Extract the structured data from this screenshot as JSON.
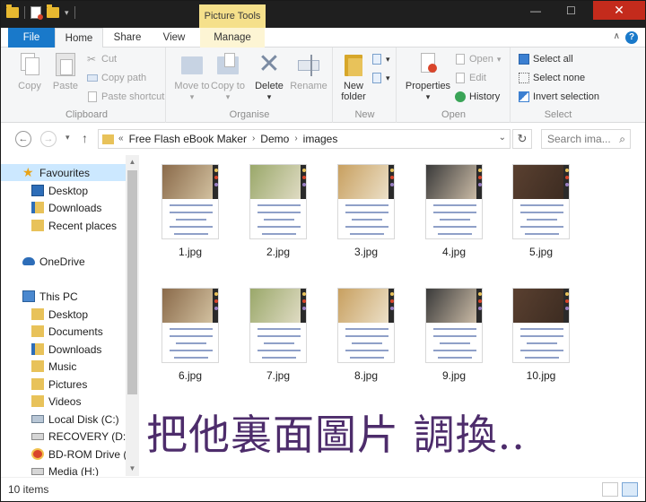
{
  "window": {
    "context_tab": "Picture Tools",
    "close_glyph": "✕",
    "minimize_glyph": "—",
    "maximize_glyph": "☐"
  },
  "tabs": {
    "file": "File",
    "home": "Home",
    "share": "Share",
    "view": "View",
    "manage": "Manage",
    "help": "?"
  },
  "ribbon": {
    "clipboard": {
      "label": "Clipboard",
      "copy": "Copy",
      "paste": "Paste",
      "cut": "Cut",
      "copy_path": "Copy path",
      "paste_shortcut": "Paste shortcut"
    },
    "organise": {
      "label": "Organise",
      "move_to": "Move to",
      "copy_to": "Copy to",
      "delete": "Delete",
      "rename": "Rename"
    },
    "new": {
      "label": "New",
      "new_folder": "New folder"
    },
    "open": {
      "label": "Open",
      "properties": "Properties",
      "open": "Open",
      "edit": "Edit",
      "history": "History"
    },
    "select": {
      "label": "Select",
      "select_all": "Select all",
      "select_none": "Select none",
      "invert_selection": "Invert selection"
    }
  },
  "address": {
    "overflow": "«",
    "crumbs": [
      "Free Flash eBook Maker",
      "Demo",
      "images"
    ],
    "search_placeholder": "Search ima..."
  },
  "nav": [
    {
      "label": "Favourites",
      "icon": "star-icon"
    },
    {
      "label": "Desktop",
      "icon": "desktop-icon"
    },
    {
      "label": "Downloads",
      "icon": "downloads-icon"
    },
    {
      "label": "Recent places",
      "icon": "recent-places-icon"
    },
    {
      "label": "OneDrive",
      "icon": "onedrive-icon"
    },
    {
      "label": "This PC",
      "icon": "this-pc-icon"
    },
    {
      "label": "Desktop",
      "icon": "desktop-folder-icon"
    },
    {
      "label": "Documents",
      "icon": "documents-icon"
    },
    {
      "label": "Downloads",
      "icon": "downloads-icon"
    },
    {
      "label": "Music",
      "icon": "music-icon"
    },
    {
      "label": "Pictures",
      "icon": "pictures-icon"
    },
    {
      "label": "Videos",
      "icon": "videos-icon"
    },
    {
      "label": "Local Disk (C:)",
      "icon": "local-disk-icon"
    },
    {
      "label": "RECOVERY (D:)",
      "icon": "drive-icon"
    },
    {
      "label": "BD-ROM Drive (F",
      "icon": "bd-rom-icon"
    },
    {
      "label": "Media (H:)",
      "icon": "drive-icon"
    }
  ],
  "files": [
    {
      "name": "1.jpg",
      "colors": [
        "#8a6a4a",
        "#d9c9a8"
      ]
    },
    {
      "name": "2.jpg",
      "colors": [
        "#9aa86a",
        "#e6e0cc"
      ]
    },
    {
      "name": "3.jpg",
      "colors": [
        "#c8a060",
        "#efe6d2"
      ]
    },
    {
      "name": "4.jpg",
      "colors": [
        "#3a3a3a",
        "#d8c7b0"
      ]
    },
    {
      "name": "5.jpg",
      "colors": [
        "#5a4030",
        "#3a2a20"
      ]
    },
    {
      "name": "6.jpg",
      "colors": [
        "#8a6a4a",
        "#d9c9a8"
      ]
    },
    {
      "name": "7.jpg",
      "colors": [
        "#9aa86a",
        "#e6e0cc"
      ]
    },
    {
      "name": "8.jpg",
      "colors": [
        "#c8a060",
        "#efe6d2"
      ]
    },
    {
      "name": "9.jpg",
      "colors": [
        "#3a3a3a",
        "#d8c7b0"
      ]
    },
    {
      "name": "10.jpg",
      "colors": [
        "#5a4030",
        "#3a2a20"
      ]
    }
  ],
  "overlay_text": "把他裏面圖片 調換..",
  "status": {
    "item_count": "10 items"
  },
  "colors": {
    "accent": "#1979ca",
    "close": "#c42b1c",
    "context_tab": "#f5e08b",
    "selection": "#cce8ff"
  }
}
